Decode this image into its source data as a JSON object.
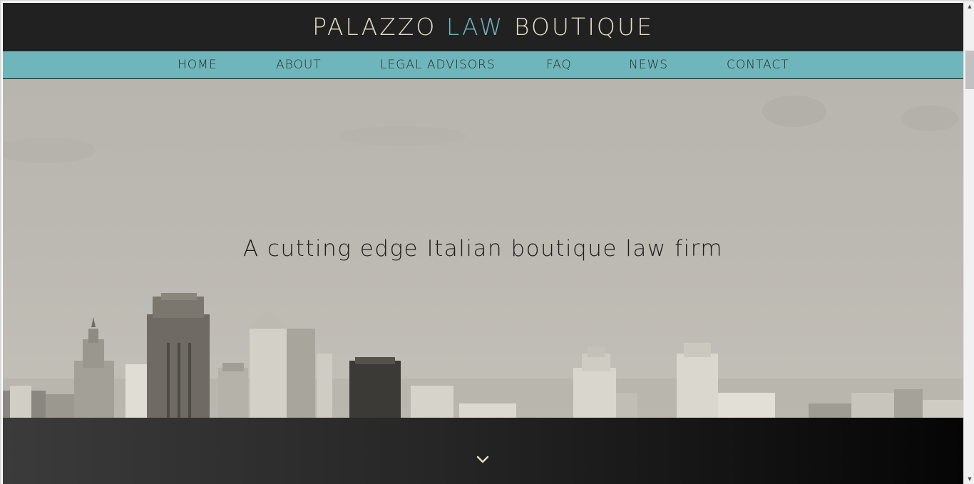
{
  "header": {
    "title_part1": "PALAZZO",
    "title_part2": "LAW",
    "title_part3": "BOUTIQUE"
  },
  "nav": {
    "items": [
      {
        "label": "HOME"
      },
      {
        "label": "ABOUT"
      },
      {
        "label": "LEGAL ADVISORS"
      },
      {
        "label": "FAQ"
      },
      {
        "label": "NEWS"
      },
      {
        "label": "CONTACT"
      }
    ]
  },
  "hero": {
    "tagline": "A cutting edge Italian boutique law firm"
  },
  "scroll": {
    "icon": "chevron-down-icon"
  },
  "colors": {
    "header_bg": "#212121",
    "title_text": "#e4dcc5",
    "title_accent": "#6fb2bf",
    "nav_bg": "#6eb6bc",
    "hero_bg": "#b9b6af"
  }
}
